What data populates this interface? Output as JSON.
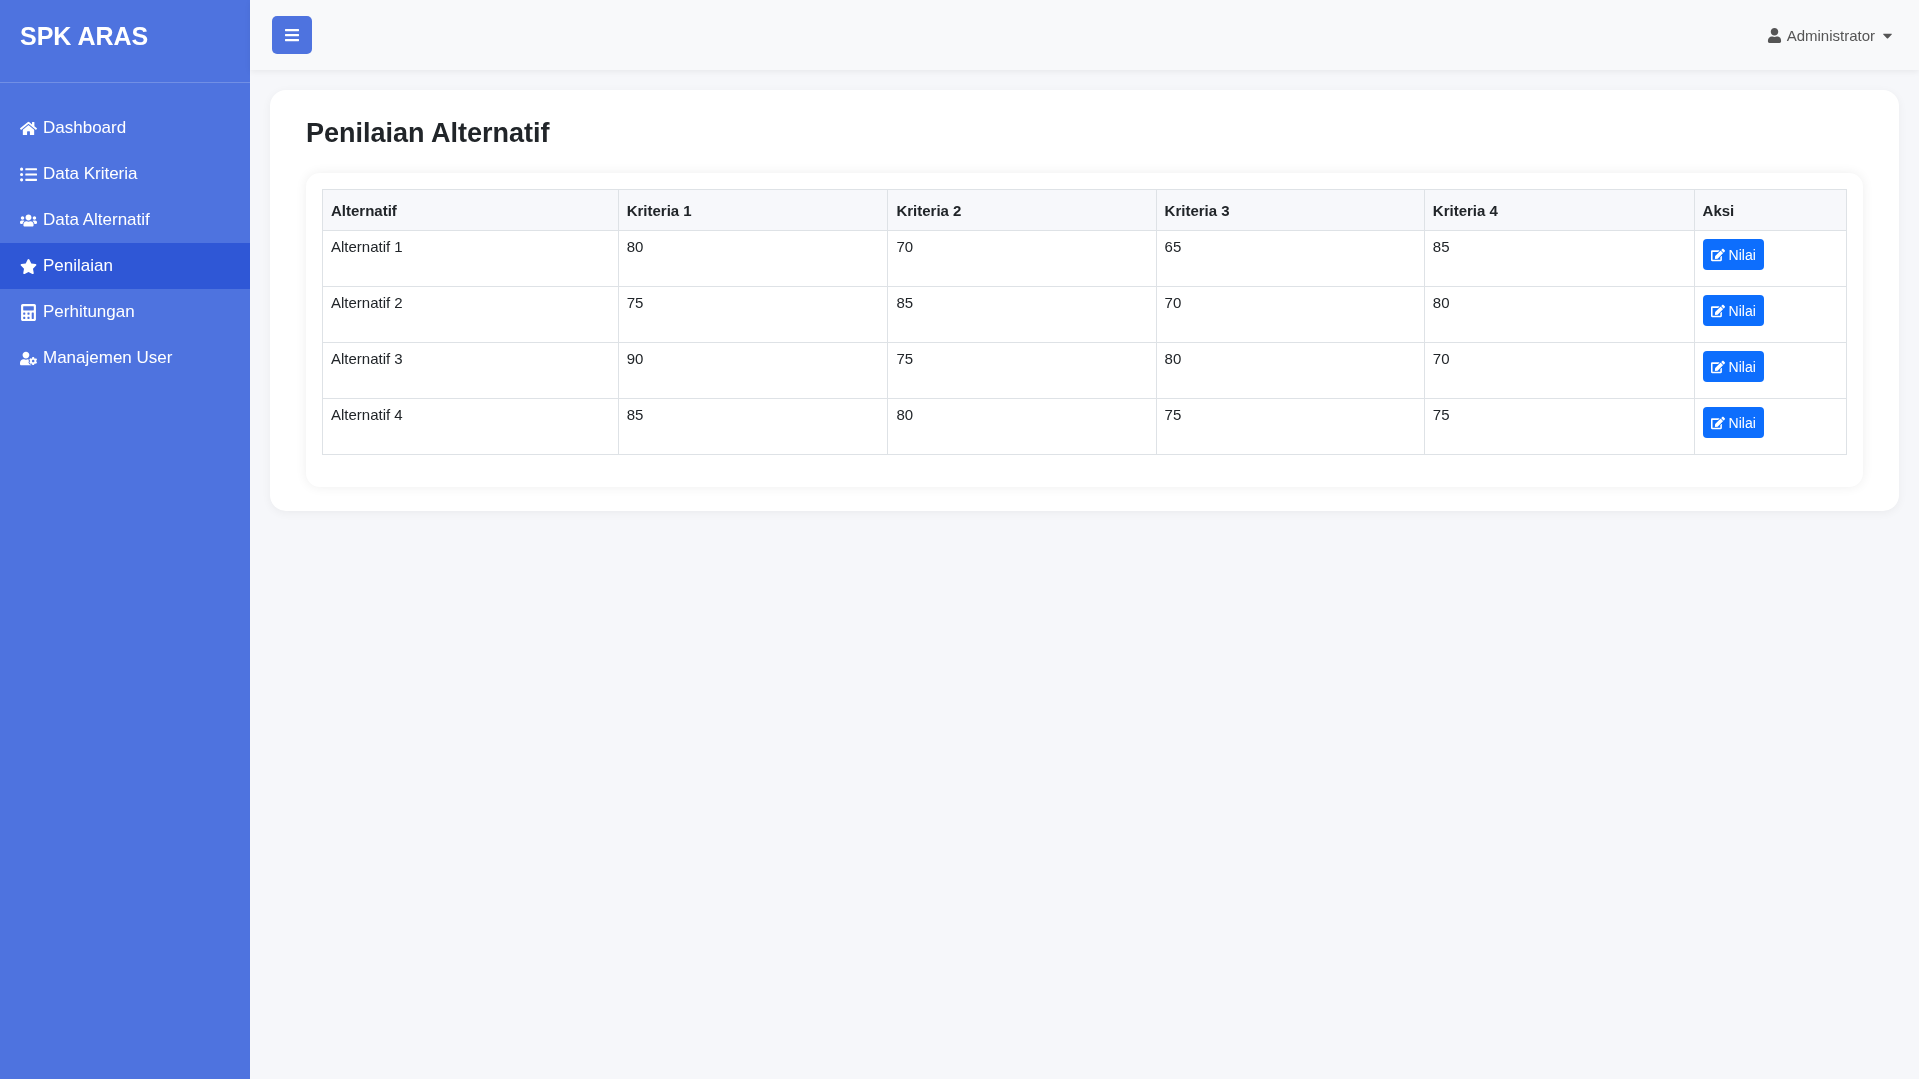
{
  "sidebar": {
    "brand": "SPK ARAS",
    "items": [
      {
        "label": "Dashboard",
        "selected": false
      },
      {
        "label": "Data Kriteria",
        "selected": false
      },
      {
        "label": "Data Alternatif",
        "selected": false
      },
      {
        "label": "Penilaian",
        "selected": true
      },
      {
        "label": "Perhitungan",
        "selected": false
      },
      {
        "label": "Manajemen User",
        "selected": false
      }
    ]
  },
  "topbar": {
    "user": "Administrator"
  },
  "page": {
    "title": "Penilaian Alternatif"
  },
  "table": {
    "columns": [
      "Alternatif",
      "Kriteria 1",
      "Kriteria 2",
      "Kriteria 3",
      "Kriteria 4",
      "Aksi"
    ],
    "rows": [
      {
        "cells": [
          "Alternatif 1",
          "80",
          "70",
          "65",
          "85"
        ],
        "action": "Nilai"
      },
      {
        "cells": [
          "Alternatif 2",
          "75",
          "85",
          "70",
          "80"
        ],
        "action": "Nilai"
      },
      {
        "cells": [
          "Alternatif 3",
          "90",
          "75",
          "80",
          "70"
        ],
        "action": "Nilai"
      },
      {
        "cells": [
          "Alternatif 4",
          "85",
          "80",
          "75",
          "75"
        ],
        "action": "Nilai"
      }
    ]
  }
}
